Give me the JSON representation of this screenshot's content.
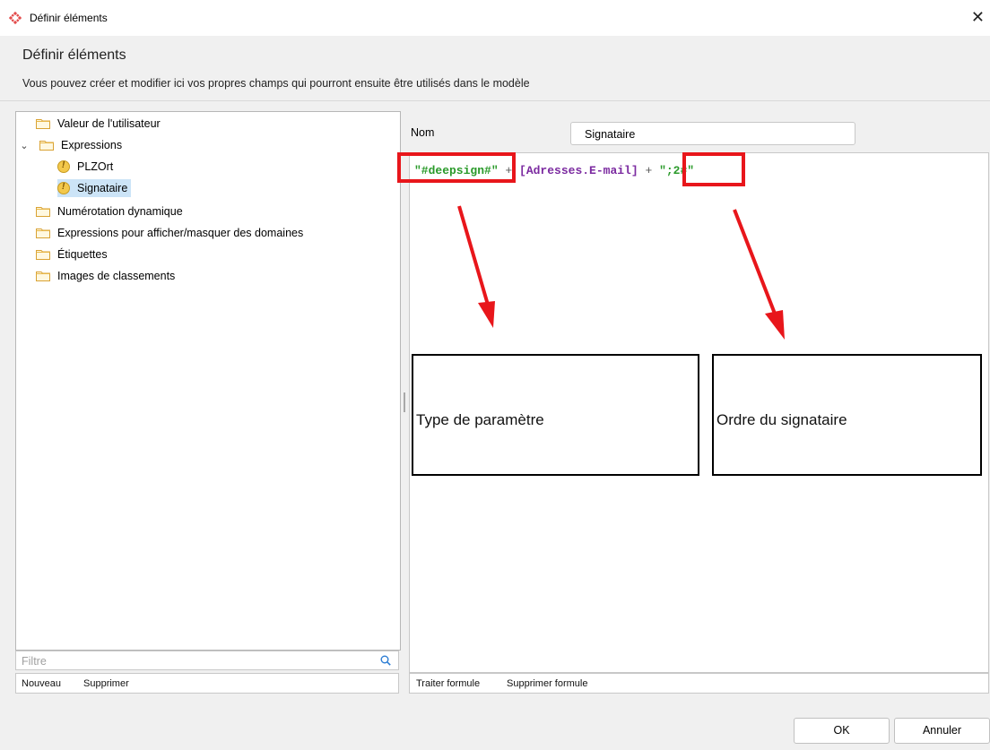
{
  "window": {
    "title": "Définir éléments"
  },
  "header": {
    "title": "Définir éléments",
    "description": "Vous pouvez créer et modifier ici vos propres champs qui pourront ensuite être utilisés dans le modèle"
  },
  "tree": {
    "items": [
      {
        "label": "Valeur de l'utilisateur",
        "icon": "folder-icon"
      },
      {
        "label": "Expressions",
        "icon": "folder-icon",
        "expanded": true
      },
      {
        "label": "PLZOrt",
        "icon": "expression-icon"
      },
      {
        "label": "Signataire",
        "icon": "expression-icon",
        "selected": true
      },
      {
        "label": "Numérotation dynamique",
        "icon": "folder-icon"
      },
      {
        "label": "Expressions pour afficher/masquer des domaines",
        "icon": "folder-icon"
      },
      {
        "label": "Étiquettes",
        "icon": "folder-icon"
      },
      {
        "label": "Images de classements",
        "icon": "folder-icon"
      }
    ]
  },
  "filter": {
    "placeholder": "Filtre"
  },
  "left_actions": {
    "new_label": "Nouveau",
    "delete_label": "Supprimer"
  },
  "name_field": {
    "label": "Nom",
    "value": "Signataire"
  },
  "formula": {
    "part1": "\"#deepsign#\"",
    "op1": " + ",
    "field": "[Adresses.E-mail]",
    "op2": " + ",
    "part2": "\";2#\""
  },
  "right_actions": {
    "edit_label": "Traiter formule",
    "delete_label": "Supprimer formule"
  },
  "annotations": {
    "param_type": "Type de paramètre",
    "signer_order": "Ordre du signataire",
    "highlight_color": "#e8161b"
  },
  "footer": {
    "ok_label": "OK",
    "cancel_label": "Annuler"
  },
  "colors": {
    "string": "#2a9a2a",
    "field": "#7b2aa0",
    "selection": "#cce4f7"
  }
}
